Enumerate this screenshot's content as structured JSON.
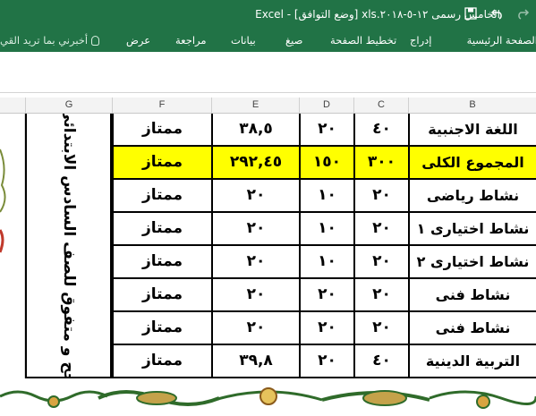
{
  "window": {
    "title": "الخامس رسمى ١٢-٥-٢٠١٨.xls  [وضع التوافق] - Excel"
  },
  "quick_access": {
    "save_icon": "save-icon",
    "undo_icon": "undo-icon",
    "redo_icon": "redo-icon"
  },
  "ribbon": {
    "tabs": [
      "الصفحة الرئيسية",
      "إدراج",
      "تخطيط الصفحة",
      "صيغ",
      "بيانات",
      "مراجعة",
      "عرض"
    ],
    "tell_me": "أخبرني بما تريد القي"
  },
  "columns": [
    "G",
    "F",
    "E",
    "D",
    "C",
    "B"
  ],
  "vertical_text": "جح و متفوق للصف السادس الابتدائى",
  "rows": [
    {
      "subject": "اللغة الاجنبية",
      "c": "٤٠",
      "d": "٢٠",
      "e": "٣٨,٥",
      "grade": "ممتاز",
      "highlight": false
    },
    {
      "subject": "المجموع الكلى",
      "c": "٣٠٠",
      "d": "١٥٠",
      "e": "٢٩٢,٤٥",
      "grade": "ممتاز",
      "highlight": true
    },
    {
      "subject": "نشاط رياضى",
      "c": "٢٠",
      "d": "١٠",
      "e": "٢٠",
      "grade": "ممتاز",
      "highlight": false
    },
    {
      "subject": "نشاط اختيارى ١",
      "c": "٢٠",
      "d": "١٠",
      "e": "٢٠",
      "grade": "ممتاز",
      "highlight": false
    },
    {
      "subject": "نشاط اختيارى ٢",
      "c": "٢٠",
      "d": "١٠",
      "e": "٢٠",
      "grade": "ممتاز",
      "highlight": false
    },
    {
      "subject": "نشاط فنى",
      "c": "٢٠",
      "d": "٢٠",
      "e": "٢٠",
      "grade": "ممتاز",
      "highlight": false
    },
    {
      "subject": "نشاط فنى",
      "c": "٢٠",
      "d": "٢٠",
      "e": "٢٠",
      "grade": "ممتاز",
      "highlight": false
    },
    {
      "subject": "التربية الدينية",
      "c": "٤٠",
      "d": "٢٠",
      "e": "٣٩,٨",
      "grade": "ممتاز",
      "highlight": false
    }
  ],
  "colors": {
    "excel_green": "#217346",
    "highlight": "#ffff00",
    "ornament": "#2f6b2a"
  }
}
